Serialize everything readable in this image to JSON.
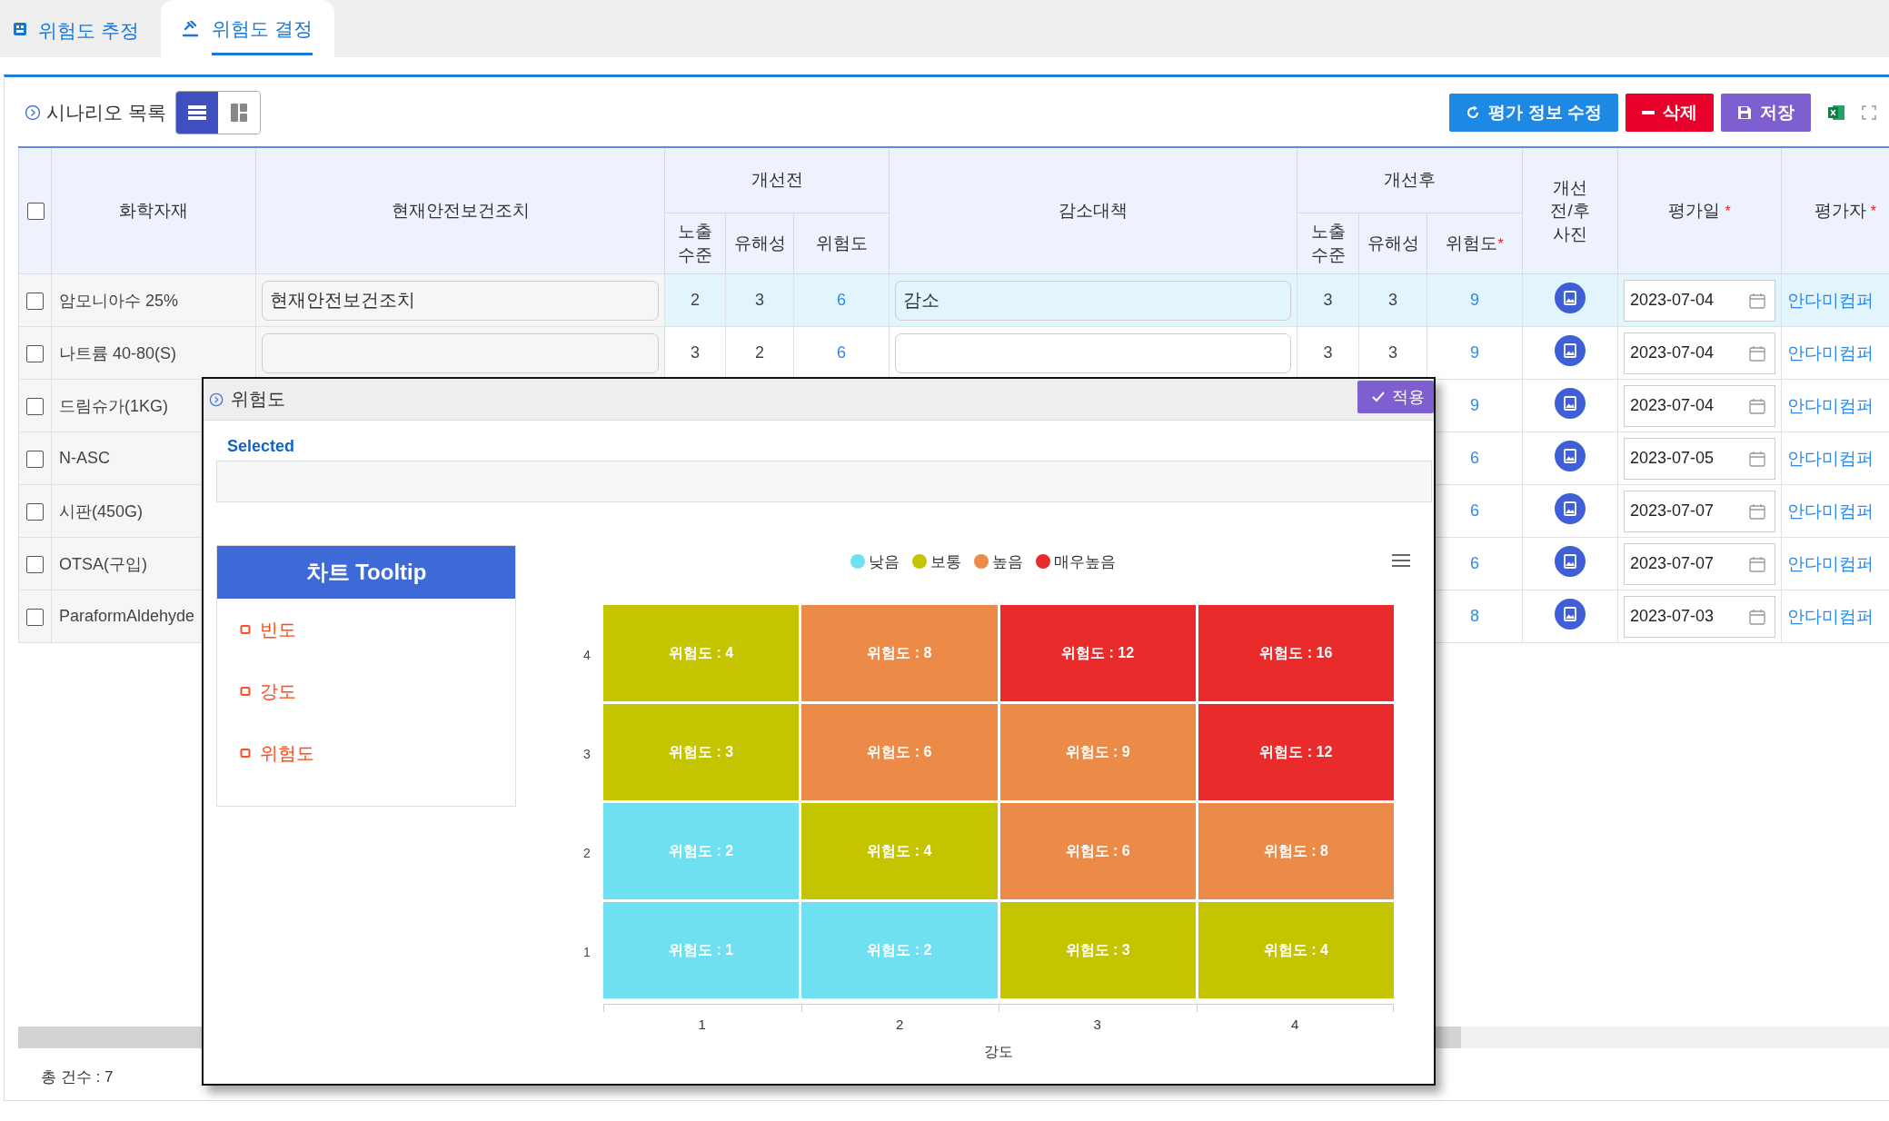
{
  "tabs": [
    {
      "label": "위험도 추정",
      "kind": "estimate",
      "selected": false
    },
    {
      "label": "위험도 결정",
      "kind": "decide",
      "selected": true
    }
  ],
  "panel": {
    "title": "시나리오 목록",
    "view_toggle": [
      {
        "kind": "list",
        "selected": true
      },
      {
        "kind": "columns",
        "selected": false
      }
    ],
    "actions": [
      {
        "kind": "edit",
        "label": "평가 정보 수정"
      },
      {
        "kind": "delete",
        "label": "삭제"
      },
      {
        "kind": "save",
        "label": "저장"
      }
    ],
    "table": {
      "header_checked": false,
      "header": {
        "material": "화학자재",
        "measures": "현재안전보건조치",
        "before": "개선전",
        "reduction": "감소대책",
        "after": "개선후",
        "photo": "개선\n전/후\n사진",
        "date": {
          "label": "평가일",
          "mark": "*"
        },
        "evaluator": {
          "label": "평가자",
          "mark": "*"
        },
        "before_sub": [
          {
            "label": "노출\n수준"
          },
          {
            "label": "유해성"
          },
          {
            "label": "위험도"
          }
        ],
        "after_sub": [
          {
            "label": "노출\n수준"
          },
          {
            "label": "유해성"
          },
          {
            "label": "위험도",
            "mark": "*"
          }
        ]
      },
      "rows": [
        {
          "checked": false,
          "selected": true,
          "material": "암모니아수 25%",
          "measures": "현재안전보건조치",
          "before": [
            "2",
            "3",
            "6"
          ],
          "reduction": "감소",
          "after": [
            "3",
            "3",
            "9"
          ],
          "date": "2023-07-04",
          "evaluator": "안다미컴퍼"
        },
        {
          "checked": false,
          "selected": false,
          "material": "나트륨 40-80(S)",
          "measures": "",
          "before": [
            "3",
            "2",
            "6"
          ],
          "reduction": "",
          "after": [
            "3",
            "3",
            "9"
          ],
          "date": "2023-07-04",
          "evaluator": "안다미컴퍼"
        },
        {
          "checked": false,
          "selected": false,
          "material": "드림슈가(1KG)",
          "after_risk": "9",
          "date": "2023-07-04",
          "evaluator": "안다미컴퍼"
        },
        {
          "checked": false,
          "selected": false,
          "material": "N-ASC",
          "after_risk": "6",
          "date": "2023-07-05",
          "evaluator": "안다미컴퍼"
        },
        {
          "checked": false,
          "selected": false,
          "material": "시판(450G)",
          "after_risk": "6",
          "date": "2023-07-07",
          "evaluator": "안다미컴퍼"
        },
        {
          "checked": false,
          "selected": false,
          "material": "OTSA(구입)",
          "after_risk": "6",
          "date": "2023-07-07",
          "evaluator": "안다미컴퍼"
        },
        {
          "checked": false,
          "selected": false,
          "material": "ParaformAldehyde",
          "after_risk": "8",
          "date": "2023-07-03",
          "evaluator": "안다미컴퍼"
        }
      ]
    },
    "total": "총 건수 : 7"
  },
  "popup": {
    "title": "위험도",
    "apply_label": "적용",
    "selected_label": "Selected",
    "tooltip_panel": {
      "title": "차트 Tooltip",
      "items": [
        {
          "label": "빈도"
        },
        {
          "label": "강도"
        },
        {
          "label": "위험도"
        }
      ]
    },
    "heatmap": {
      "legend": [
        {
          "label": "낮음",
          "color": "#6fe0f2"
        },
        {
          "label": "보통",
          "color": "#c5c400"
        },
        {
          "label": "높음",
          "color": "#eb8b47"
        },
        {
          "label": "매우높음",
          "color": "#e92b2b"
        }
      ],
      "y_ticks": [
        "4",
        "3",
        "2",
        "1"
      ],
      "x_ticks": [
        "1",
        "2",
        "3",
        "4"
      ],
      "x_title": "강도",
      "rows": [
        [
          {
            "label": "위험도 : 4",
            "color": "#c5c400"
          },
          {
            "label": "위험도 : 8",
            "color": "#eb8b47"
          },
          {
            "label": "위험도 : 12",
            "color": "#e92b2b"
          },
          {
            "label": "위험도 : 16",
            "color": "#e92b2b"
          }
        ],
        [
          {
            "label": "위험도 : 3",
            "color": "#c5c400"
          },
          {
            "label": "위험도 : 6",
            "color": "#eb8b47"
          },
          {
            "label": "위험도 : 9",
            "color": "#eb8b47"
          },
          {
            "label": "위험도 : 12",
            "color": "#e92b2b"
          }
        ],
        [
          {
            "label": "위험도 : 2",
            "color": "#6fe0f2"
          },
          {
            "label": "위험도 : 4",
            "color": "#c5c400"
          },
          {
            "label": "위험도 : 6",
            "color": "#eb8b47"
          },
          {
            "label": "위험도 : 8",
            "color": "#eb8b47"
          }
        ],
        [
          {
            "label": "위험도 : 1",
            "color": "#6fe0f2"
          },
          {
            "label": "위험도 : 2",
            "color": "#6fe0f2"
          },
          {
            "label": "위험도 : 3",
            "color": "#c5c400"
          },
          {
            "label": "위험도 : 4",
            "color": "#c5c400"
          }
        ]
      ]
    }
  }
}
